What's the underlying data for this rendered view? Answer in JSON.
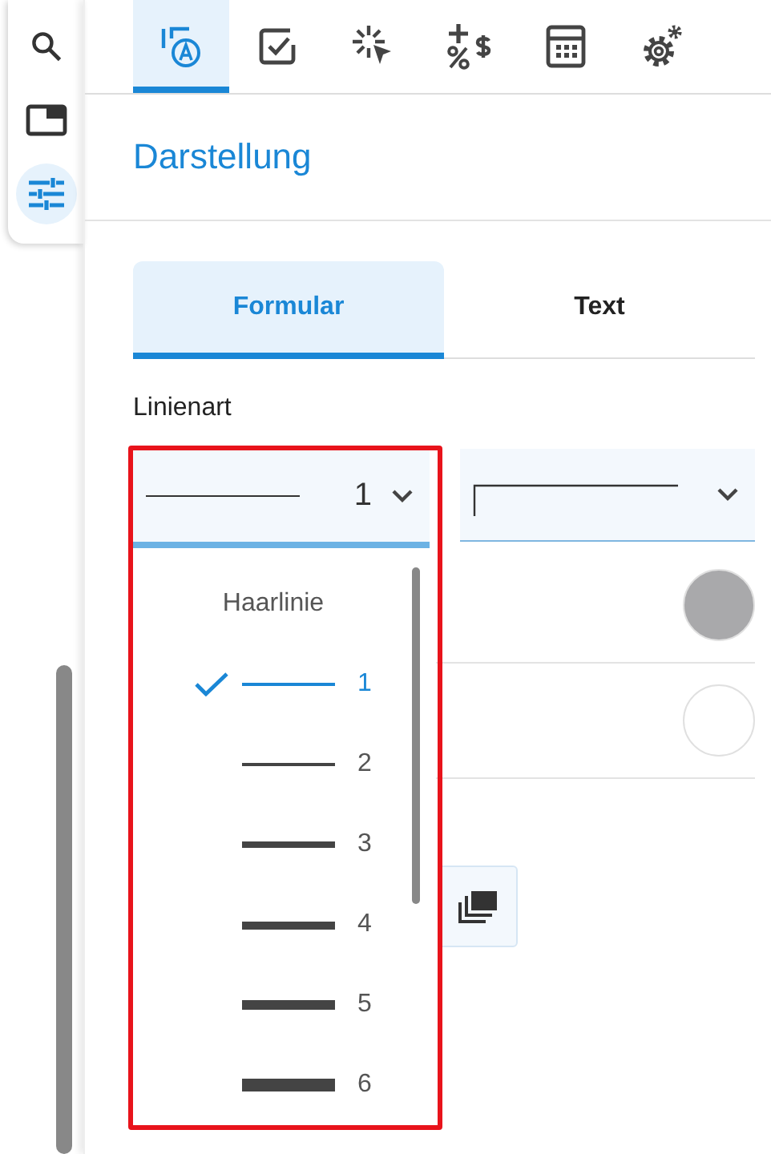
{
  "sidebar": {
    "tools": [
      {
        "selected": false
      },
      {
        "selected": false
      },
      {
        "selected": true
      }
    ]
  },
  "toolbar": {
    "tabs": [
      {
        "selected": true
      },
      {
        "selected": false
      },
      {
        "selected": false
      },
      {
        "selected": false
      },
      {
        "selected": false
      },
      {
        "selected": false
      }
    ]
  },
  "panel": {
    "title": "Darstellung",
    "tabs": [
      {
        "label": "Formular",
        "selected": true
      },
      {
        "label": "Text",
        "selected": false
      }
    ],
    "line_style": {
      "label": "Linienart",
      "value": "1",
      "expanded": true,
      "options": [
        {
          "label": "Haarlinie",
          "kind": "hairline",
          "selected": false
        },
        {
          "label": "1",
          "kind": "line",
          "selected": true
        },
        {
          "label": "2",
          "kind": "line",
          "selected": false
        },
        {
          "label": "3",
          "kind": "line",
          "selected": false
        },
        {
          "label": "4",
          "kind": "line",
          "selected": false
        },
        {
          "label": "5",
          "kind": "line",
          "selected": false
        },
        {
          "label": "6",
          "kind": "line",
          "selected": false
        }
      ]
    },
    "colors": [
      {
        "color": "#a9a9ab"
      },
      {
        "color": "#ffffff"
      }
    ]
  }
}
